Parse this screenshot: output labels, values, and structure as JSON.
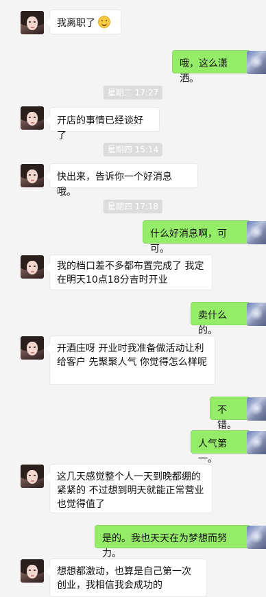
{
  "messages": [
    {
      "type": "in",
      "text": "我离职了",
      "emoji": "smile-emoji"
    },
    {
      "type": "out",
      "text": "哦，这么潇洒。"
    },
    {
      "type": "time",
      "text": "星期二 17:27"
    },
    {
      "type": "in",
      "text": "开店的事情已经谈好了"
    },
    {
      "type": "time",
      "text": "星期四 15:14"
    },
    {
      "type": "in",
      "text": "快出来，告诉你一个好消息哦。"
    },
    {
      "type": "time",
      "text": "星期四 17:18"
    },
    {
      "type": "out",
      "text": "什么好消息啊，可可。"
    },
    {
      "type": "in",
      "text": "我的档口差不多都布置完成了  我定在明天10点18分吉时开业"
    },
    {
      "type": "out",
      "text": "卖什么的。"
    },
    {
      "type": "in",
      "text": "开酒庄呀   开业时我准备做活动让利给客户  先聚聚人气  你觉得怎么样呢"
    },
    {
      "type": "out",
      "text": "不错。"
    },
    {
      "type": "out",
      "text": "人气第一。"
    },
    {
      "type": "in",
      "text": "这几天感觉整个人一天到晚都绷的紧紧的 不过想到明天就能正常营业也觉得值了"
    },
    {
      "type": "out",
      "text": "是的。我也天天在为梦想而努力。"
    },
    {
      "type": "in",
      "text": "想想都激动，也算是自己第一次创业，我相信我会成功的"
    }
  ]
}
